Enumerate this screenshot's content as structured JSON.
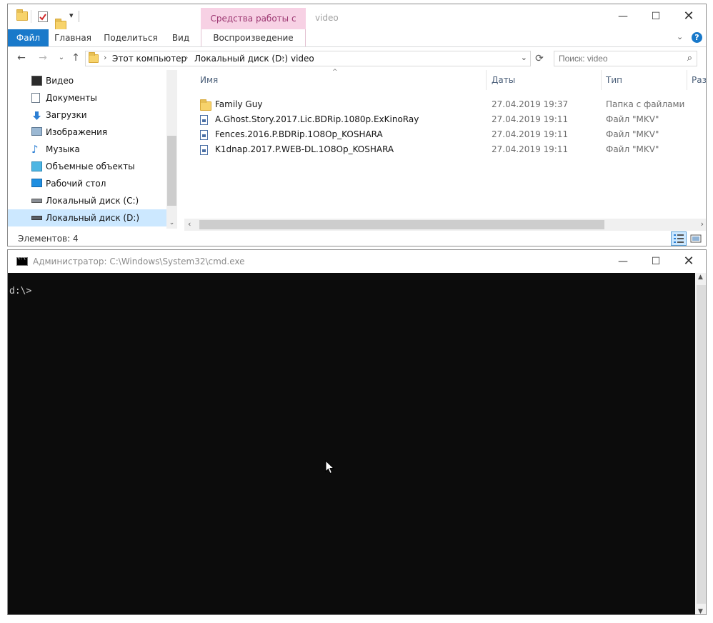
{
  "explorer": {
    "title": "video",
    "contextual_tab": "Средства работы с видео",
    "ribbon_tabs": [
      "Файл",
      "Главная",
      "Поделиться",
      "Вид",
      "Воспроизведение"
    ],
    "breadcrumb": [
      "Этот компьютер",
      "Локальный диск (D:)",
      "video"
    ],
    "search_placeholder": "Поиск: video",
    "nav": [
      {
        "label": "Видео",
        "icon": "video-icon"
      },
      {
        "label": "Документы",
        "icon": "documents-icon"
      },
      {
        "label": "Загрузки",
        "icon": "downloads-icon"
      },
      {
        "label": "Изображения",
        "icon": "pictures-icon"
      },
      {
        "label": "Музыка",
        "icon": "music-icon"
      },
      {
        "label": "Объемные объекты",
        "icon": "3d-objects-icon"
      },
      {
        "label": "Рабочий стол",
        "icon": "desktop-icon"
      },
      {
        "label": "Локальный диск (C:)",
        "icon": "drive-icon"
      },
      {
        "label": "Локальный диск (D:)",
        "icon": "drive-icon",
        "selected": true
      }
    ],
    "columns": [
      "Имя",
      "Даты",
      "Тип",
      "Разме"
    ],
    "files": [
      {
        "name": "Family Guy",
        "date": "27.04.2019 19:37",
        "type": "Папка с файлами",
        "icon": "folder-icon"
      },
      {
        "name": "A.Ghost.Story.2017.Lic.BDRip.1080p.ExKinoRay",
        "date": "27.04.2019 19:11",
        "type": "Файл \"MKV\"",
        "icon": "mkv-file-icon"
      },
      {
        "name": "Fences.2016.P.BDRip.1O8Op_KOSHARA",
        "date": "27.04.2019 19:11",
        "type": "Файл \"MKV\"",
        "icon": "mkv-file-icon"
      },
      {
        "name": "K1dnap.2017.P.WEB-DL.1O8Op_KOSHARA",
        "date": "27.04.2019 19:11",
        "type": "Файл \"MKV\"",
        "icon": "mkv-file-icon"
      }
    ],
    "status": "Элементов: 4",
    "colors": {
      "accent": "#1979ca",
      "contextual": "#f7d1e4",
      "selection": "#cce8ff"
    }
  },
  "cmd": {
    "title": "Администратор: C:\\Windows\\System32\\cmd.exe",
    "prompt": "d:\\>"
  }
}
